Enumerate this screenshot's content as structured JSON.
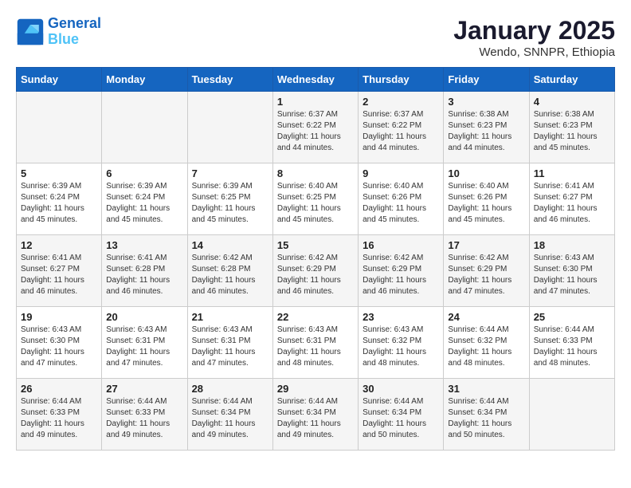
{
  "header": {
    "logo_line1": "General",
    "logo_line2": "Blue",
    "month": "January 2025",
    "location": "Wendo, SNNPR, Ethiopia"
  },
  "days_of_week": [
    "Sunday",
    "Monday",
    "Tuesday",
    "Wednesday",
    "Thursday",
    "Friday",
    "Saturday"
  ],
  "weeks": [
    [
      {
        "day": "",
        "info": ""
      },
      {
        "day": "",
        "info": ""
      },
      {
        "day": "",
        "info": ""
      },
      {
        "day": "1",
        "info": "Sunrise: 6:37 AM\nSunset: 6:22 PM\nDaylight: 11 hours and 44 minutes."
      },
      {
        "day": "2",
        "info": "Sunrise: 6:37 AM\nSunset: 6:22 PM\nDaylight: 11 hours and 44 minutes."
      },
      {
        "day": "3",
        "info": "Sunrise: 6:38 AM\nSunset: 6:23 PM\nDaylight: 11 hours and 44 minutes."
      },
      {
        "day": "4",
        "info": "Sunrise: 6:38 AM\nSunset: 6:23 PM\nDaylight: 11 hours and 45 minutes."
      }
    ],
    [
      {
        "day": "5",
        "info": "Sunrise: 6:39 AM\nSunset: 6:24 PM\nDaylight: 11 hours and 45 minutes."
      },
      {
        "day": "6",
        "info": "Sunrise: 6:39 AM\nSunset: 6:24 PM\nDaylight: 11 hours and 45 minutes."
      },
      {
        "day": "7",
        "info": "Sunrise: 6:39 AM\nSunset: 6:25 PM\nDaylight: 11 hours and 45 minutes."
      },
      {
        "day": "8",
        "info": "Sunrise: 6:40 AM\nSunset: 6:25 PM\nDaylight: 11 hours and 45 minutes."
      },
      {
        "day": "9",
        "info": "Sunrise: 6:40 AM\nSunset: 6:26 PM\nDaylight: 11 hours and 45 minutes."
      },
      {
        "day": "10",
        "info": "Sunrise: 6:40 AM\nSunset: 6:26 PM\nDaylight: 11 hours and 45 minutes."
      },
      {
        "day": "11",
        "info": "Sunrise: 6:41 AM\nSunset: 6:27 PM\nDaylight: 11 hours and 46 minutes."
      }
    ],
    [
      {
        "day": "12",
        "info": "Sunrise: 6:41 AM\nSunset: 6:27 PM\nDaylight: 11 hours and 46 minutes."
      },
      {
        "day": "13",
        "info": "Sunrise: 6:41 AM\nSunset: 6:28 PM\nDaylight: 11 hours and 46 minutes."
      },
      {
        "day": "14",
        "info": "Sunrise: 6:42 AM\nSunset: 6:28 PM\nDaylight: 11 hours and 46 minutes."
      },
      {
        "day": "15",
        "info": "Sunrise: 6:42 AM\nSunset: 6:29 PM\nDaylight: 11 hours and 46 minutes."
      },
      {
        "day": "16",
        "info": "Sunrise: 6:42 AM\nSunset: 6:29 PM\nDaylight: 11 hours and 46 minutes."
      },
      {
        "day": "17",
        "info": "Sunrise: 6:42 AM\nSunset: 6:29 PM\nDaylight: 11 hours and 47 minutes."
      },
      {
        "day": "18",
        "info": "Sunrise: 6:43 AM\nSunset: 6:30 PM\nDaylight: 11 hours and 47 minutes."
      }
    ],
    [
      {
        "day": "19",
        "info": "Sunrise: 6:43 AM\nSunset: 6:30 PM\nDaylight: 11 hours and 47 minutes."
      },
      {
        "day": "20",
        "info": "Sunrise: 6:43 AM\nSunset: 6:31 PM\nDaylight: 11 hours and 47 minutes."
      },
      {
        "day": "21",
        "info": "Sunrise: 6:43 AM\nSunset: 6:31 PM\nDaylight: 11 hours and 47 minutes."
      },
      {
        "day": "22",
        "info": "Sunrise: 6:43 AM\nSunset: 6:31 PM\nDaylight: 11 hours and 48 minutes."
      },
      {
        "day": "23",
        "info": "Sunrise: 6:43 AM\nSunset: 6:32 PM\nDaylight: 11 hours and 48 minutes."
      },
      {
        "day": "24",
        "info": "Sunrise: 6:44 AM\nSunset: 6:32 PM\nDaylight: 11 hours and 48 minutes."
      },
      {
        "day": "25",
        "info": "Sunrise: 6:44 AM\nSunset: 6:33 PM\nDaylight: 11 hours and 48 minutes."
      }
    ],
    [
      {
        "day": "26",
        "info": "Sunrise: 6:44 AM\nSunset: 6:33 PM\nDaylight: 11 hours and 49 minutes."
      },
      {
        "day": "27",
        "info": "Sunrise: 6:44 AM\nSunset: 6:33 PM\nDaylight: 11 hours and 49 minutes."
      },
      {
        "day": "28",
        "info": "Sunrise: 6:44 AM\nSunset: 6:34 PM\nDaylight: 11 hours and 49 minutes."
      },
      {
        "day": "29",
        "info": "Sunrise: 6:44 AM\nSunset: 6:34 PM\nDaylight: 11 hours and 49 minutes."
      },
      {
        "day": "30",
        "info": "Sunrise: 6:44 AM\nSunset: 6:34 PM\nDaylight: 11 hours and 50 minutes."
      },
      {
        "day": "31",
        "info": "Sunrise: 6:44 AM\nSunset: 6:34 PM\nDaylight: 11 hours and 50 minutes."
      },
      {
        "day": "",
        "info": ""
      }
    ]
  ]
}
